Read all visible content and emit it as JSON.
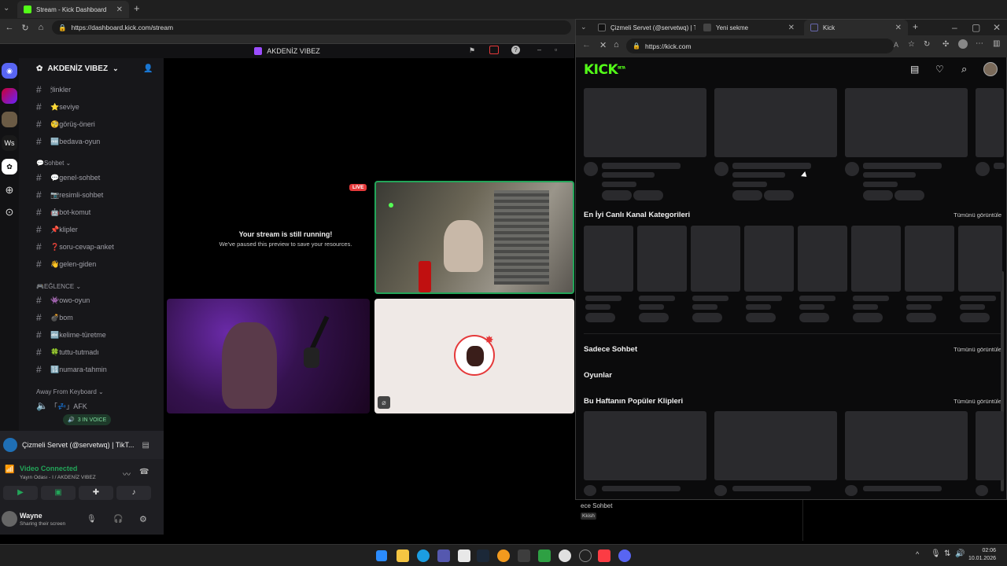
{
  "back_browser": {
    "tab_title": "Stream - Kick Dashboard",
    "url": "https://dashboard.kick.com/stream"
  },
  "discord": {
    "window_title": "AKDENİZ VIBEZ",
    "server_name": "AKDENİZ VIBEZ",
    "guild_label": "Ws",
    "channels_top": [
      {
        "name": "🕯linkler"
      },
      {
        "name": "⭐seviye"
      },
      {
        "name": "🧐görüş-öneri"
      },
      {
        "name": "🆓bedava-oyun"
      }
    ],
    "category_sohbet": "💬Sohbet",
    "channels_sohbet": [
      {
        "name": "💬genel-sohbet"
      },
      {
        "name": "📷resimli-sohbet"
      },
      {
        "name": "🤖bot-komut"
      },
      {
        "name": "📌klipler"
      },
      {
        "name": "❓soru-cevap-anket"
      },
      {
        "name": "👋gelen-giden"
      }
    ],
    "category_eglence": "🎮EĞLENCE",
    "channels_eglence": [
      {
        "name": "👾owo-oyun"
      },
      {
        "name": "💣bom"
      },
      {
        "name": "🔤kelime-türetme"
      },
      {
        "name": "🍀tuttu-tutmadı"
      },
      {
        "name": "🔢numara-tahmin"
      }
    ],
    "category_afk": "Away From Keyboard",
    "afk_channel": "「💤」AFK",
    "in_voice": "3 IN VOICE",
    "activity_title": "Çizmeli Servet (@servetwq) | TikT...",
    "video_connected": "Video Connected",
    "voice_location": "Yayın Odası - I / AKDENİZ VIBEZ",
    "user_name": "Wayne",
    "user_status": "Sharing their screen",
    "stage": {
      "live_badge": "LIVE",
      "paused_title": "Your stream is still running!",
      "paused_sub": "We've paused this preview to save your resources."
    }
  },
  "kick_browser": {
    "tabs": [
      {
        "title": "Çizmeli Servet (@servetwq) | Tik"
      },
      {
        "title": "Yeni sekme"
      },
      {
        "title": "Kick"
      }
    ],
    "url": "https://kick.com",
    "logo": "KICK",
    "logo_beta": "BETA",
    "sections": {
      "categories": "En İyi Canlı Kanal Kategorileri",
      "just_chatting": "Sadece Sohbet",
      "games": "Oyunlar",
      "clips": "Bu Haftanın Popüler Klipleri"
    },
    "see_all": "Tümünü görüntüle"
  },
  "behind_text": {
    "line1": "ece Sohbet",
    "line2": "Kkish"
  },
  "taskbar": {
    "time": "02:06",
    "date": "10.01.2026"
  },
  "colors": {
    "kick_green": "#53fc18",
    "discord_green": "#23a559",
    "live_red": "#e5393a"
  }
}
